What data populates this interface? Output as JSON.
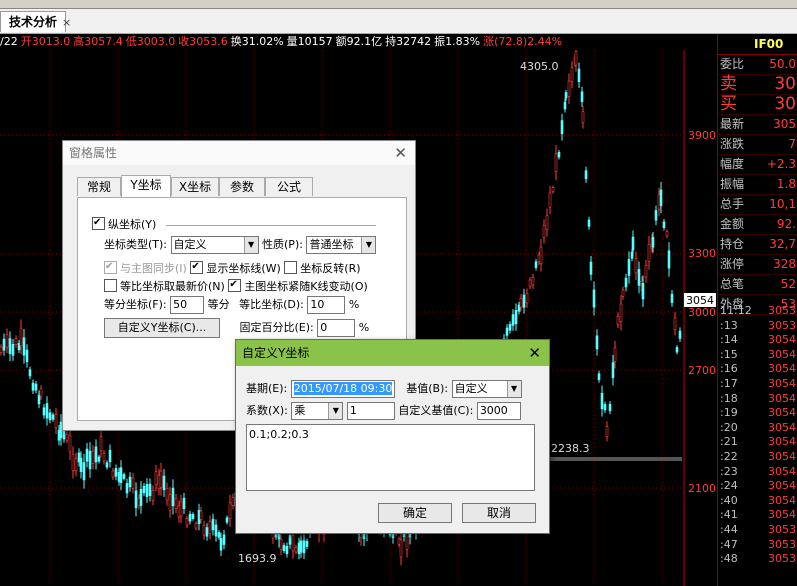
{
  "window": {
    "tab_label": "技术分析",
    "tab_close": "×"
  },
  "infobar": {
    "date": "/22",
    "open": "开3013.0",
    "high": "高3057.4",
    "low": "低3003.0",
    "close": "收3053.6",
    "turnover": "换31.02%",
    "volume": "量10157",
    "amount": "额92.1亿",
    "holding": "持32742",
    "amplitude": "振1.83%",
    "change": "涨(72.8)2.44%"
  },
  "chart": {
    "price_levels": [
      "3900",
      "3300",
      "3000",
      "2700",
      "2100"
    ],
    "current_price": "3054",
    "max_label": "4305.0",
    "min_label": "1693.9",
    "mid_label": "2238.3"
  },
  "right_panel": {
    "code": "IF00",
    "header_suffix": "30",
    "rows": [
      {
        "label": "委比",
        "value": "50.0"
      },
      {
        "label": "卖",
        "value": "30"
      },
      {
        "label": "买",
        "value": "30"
      },
      {
        "label": "最新",
        "value": "305"
      },
      {
        "label": "涨跌",
        "value": "7"
      },
      {
        "label": "幅度",
        "value": "+2.3"
      },
      {
        "label": "振幅",
        "value": "1.8"
      },
      {
        "label": "总手",
        "value": "10,1"
      },
      {
        "label": "金额",
        "value": "92."
      },
      {
        "label": "持仓",
        "value": "32,7"
      },
      {
        "label": "涨停",
        "value": "328"
      },
      {
        "label": "总笔",
        "value": "52"
      },
      {
        "label": "外盘",
        "value": "53"
      }
    ],
    "ticks": [
      {
        "t": "11:12",
        "v": "3053"
      },
      {
        "t": ":13",
        "v": "3053"
      },
      {
        "t": ":14",
        "v": "3054"
      },
      {
        "t": ":15",
        "v": "3054"
      },
      {
        "t": ":16",
        "v": "3054"
      },
      {
        "t": ":17",
        "v": "3054"
      },
      {
        "t": ":18",
        "v": "3054"
      },
      {
        "t": ":19",
        "v": "3054"
      },
      {
        "t": ":20",
        "v": "3054"
      },
      {
        "t": ":21",
        "v": "3054"
      },
      {
        "t": ":22",
        "v": "3054"
      },
      {
        "t": ":23",
        "v": "3054"
      },
      {
        "t": ":24",
        "v": "3054"
      },
      {
        "t": ":40",
        "v": "3054"
      },
      {
        "t": ":41",
        "v": "3054"
      },
      {
        "t": ":44",
        "v": "3053"
      },
      {
        "t": ":47",
        "v": "3053"
      },
      {
        "t": ":48",
        "v": "3053"
      }
    ]
  },
  "dialog_props": {
    "title": "窗格属性",
    "tabs": [
      "常规",
      "Y坐标",
      "X坐标",
      "参数",
      "公式"
    ],
    "y_axis_label": "纵坐标(Y)",
    "axis_type_label": "坐标类型(T):",
    "axis_type_value": "自定义",
    "nature_label": "性质(P):",
    "nature_value": "普通坐标",
    "sync_label": "与主图同步(I)",
    "show_axis_line": "显示坐标线(W)",
    "reverse_axis": "坐标反转(R)",
    "ratio_latest": "等比坐标取最新价(N)",
    "follow_k": "主图坐标紧随K线变动(O)",
    "equal_div_label": "等分坐标(F):",
    "equal_div_value": "50",
    "equal_div_unit": "等分",
    "ratio_axis_label": "等比坐标(D):",
    "ratio_axis_value": "10",
    "percent": "%",
    "custom_button": "自定义Y坐标(C)...",
    "fixed_pct_label": "固定百分比(E):",
    "fixed_pct_value": "0"
  },
  "dialog_custom": {
    "title": "自定义Y坐标",
    "base_period_label": "基期(E):",
    "base_period_value": "2015/07/18 09:30",
    "base_value_label": "基值(B):",
    "base_value_value": "自定义",
    "coef_label": "系数(X):",
    "coef_op": "乘",
    "coef_value": "1",
    "custom_base_label": "自定义基值(C):",
    "custom_base_value": "3000",
    "text_content": "0.1;0.2;0.3",
    "ok": "确定",
    "cancel": "取消"
  }
}
